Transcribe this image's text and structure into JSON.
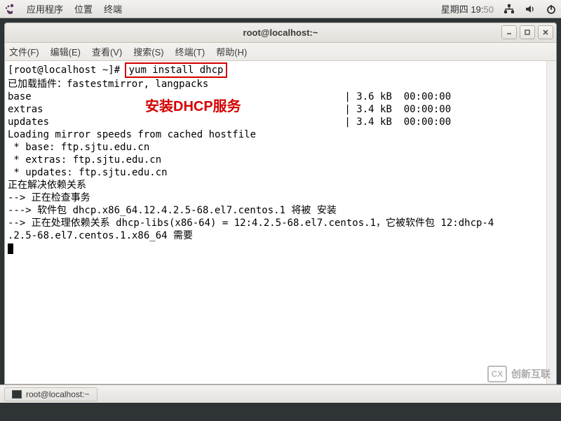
{
  "panel": {
    "apps": "应用程序",
    "places": "位置",
    "terminal": "终端",
    "day": "星期四",
    "hour": "19",
    "minute": "50"
  },
  "window": {
    "title": "root@localhost:~",
    "menu": {
      "file": "文件(F)",
      "edit": "编辑(E)",
      "view": "查看(V)",
      "search": "搜索(S)",
      "terminal": "终端(T)",
      "help": "帮助(H)"
    }
  },
  "terminal": {
    "prompt": "[root@localhost ~]#",
    "command": "yum install dhcp",
    "lines": [
      "已加载插件：fastestmirror, langpacks",
      "base                                                     | 3.6 kB  00:00:00",
      "extras                                                   | 3.4 kB  00:00:00",
      "updates                                                  | 3.4 kB  00:00:00",
      "Loading mirror speeds from cached hostfile",
      " * base: ftp.sjtu.edu.cn",
      " * extras: ftp.sjtu.edu.cn",
      " * updates: ftp.sjtu.edu.cn",
      "正在解决依赖关系",
      "--> 正在检查事务",
      "---> 软件包 dhcp.x86_64.12.4.2.5-68.el7.centos.1 将被 安装",
      "--> 正在处理依赖关系 dhcp-libs(x86-64) = 12:4.2.5-68.el7.centos.1，它被软件包 12:dhcp-4",
      ".2.5-68.el7.centos.1.x86_64 需要"
    ],
    "annotation": "安装DHCP服务"
  },
  "taskbar": {
    "task": "root@localhost:~"
  },
  "watermark": {
    "brand_short": "CX",
    "brand": "创新互联"
  }
}
